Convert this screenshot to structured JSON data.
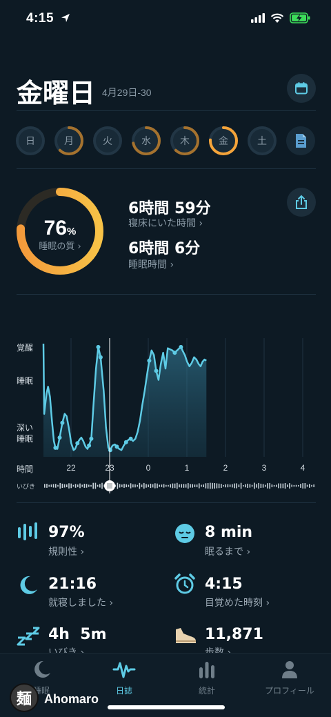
{
  "status": {
    "time": "4:15"
  },
  "header": {
    "day": "金曜日",
    "date_range": "4月29日-30"
  },
  "week": [
    {
      "label": "日",
      "fill": 0,
      "active": false
    },
    {
      "label": "月",
      "fill": 0.62,
      "active": false
    },
    {
      "label": "火",
      "fill": 0,
      "active": false
    },
    {
      "label": "水",
      "fill": 0.72,
      "active": false
    },
    {
      "label": "木",
      "fill": 0.62,
      "active": false
    },
    {
      "label": "金",
      "fill": 0.76,
      "active": true
    },
    {
      "label": "土",
      "fill": 0,
      "active": false
    }
  ],
  "summary": {
    "quality_value": "76",
    "quality_unit": "%",
    "quality_label": "睡眠の質 ›",
    "quality_fraction": 0.76,
    "time_in_bed": "6時間 59分",
    "time_in_bed_label": "寝床にいた時間 ›",
    "sleep_time": "6時間 6分",
    "sleep_time_label": "睡眠時間 ›"
  },
  "chart_data": {
    "type": "line",
    "y_labels": [
      "覚醒",
      "睡眠",
      "深い\n睡眠"
    ],
    "x_axis_label": "時間",
    "x_ticks": [
      "22",
      "23",
      "0",
      "1",
      "2",
      "3",
      "4"
    ],
    "snore_label": "いびき",
    "series": [
      {
        "x": [
          0.0,
          0.02,
          0.08,
          0.12,
          0.17,
          0.22,
          0.27,
          0.31,
          0.36,
          0.42,
          0.49,
          0.55,
          0.6,
          0.66,
          0.72,
          0.78,
          0.82,
          0.88,
          0.93,
          0.98,
          1.03,
          1.09,
          1.14,
          1.18,
          1.24,
          1.3,
          1.36,
          1.42,
          1.48,
          1.56,
          1.62,
          1.68,
          1.73,
          1.79,
          1.85,
          1.9,
          1.96,
          2.02,
          2.08,
          2.14,
          2.2,
          2.26,
          2.32,
          2.38,
          2.44,
          2.5,
          2.56,
          2.62,
          2.68,
          2.74,
          2.8,
          2.86,
          2.92,
          2.98,
          3.04,
          3.1,
          3.16,
          3.22,
          3.28,
          3.34,
          3.4,
          3.46,
          3.52,
          3.56,
          3.6,
          3.66,
          3.72,
          3.78,
          3.84,
          3.9,
          3.96,
          4.02,
          4.07,
          4.12,
          4.17,
          4.22
        ],
        "y": [
          1.0,
          0.38,
          0.56,
          0.62,
          0.53,
          0.32,
          0.14,
          0.08,
          0.07,
          0.17,
          0.3,
          0.38,
          0.36,
          0.25,
          0.12,
          0.06,
          0.07,
          0.12,
          0.15,
          0.17,
          0.14,
          0.09,
          0.07,
          0.1,
          0.16,
          0.48,
          0.78,
          0.97,
          0.88,
          0.58,
          0.26,
          0.08,
          0.06,
          0.1,
          0.11,
          0.09,
          0.07,
          0.06,
          0.1,
          0.13,
          0.15,
          0.16,
          0.14,
          0.16,
          0.22,
          0.32,
          0.46,
          0.58,
          0.72,
          0.85,
          0.94,
          0.9,
          0.76,
          0.68,
          0.82,
          0.92,
          0.78,
          0.96,
          0.95,
          0.94,
          0.92,
          0.94,
          0.96,
          0.97,
          0.94,
          0.9,
          0.84,
          0.8,
          0.83,
          0.88,
          0.86,
          0.82,
          0.8,
          0.84,
          0.86,
          0.85
        ]
      }
    ]
  },
  "stats": [
    {
      "value": "97%",
      "label": "規則性 ›",
      "icon": "bars-icon"
    },
    {
      "value": "8 min",
      "label": "眠るまで ›",
      "icon": "sleepy-face-icon"
    },
    {
      "value": "21:16",
      "label": "就寝しました ›",
      "icon": "moon-icon"
    },
    {
      "value": "4:15",
      "label": "目覚めた時刻 ›",
      "icon": "alarm-clock-icon"
    },
    {
      "value": "4h  5m",
      "label": "いびき ›",
      "icon": "zzz-icon"
    },
    {
      "value": "11,871",
      "label": "歩数 ›",
      "icon": "shoe-icon"
    }
  ],
  "tabs": [
    {
      "label": "睡眠",
      "active": false
    },
    {
      "label": "日誌",
      "active": true
    },
    {
      "label": "統計",
      "active": false
    },
    {
      "label": "プロフィール",
      "active": false
    }
  ],
  "overlay": {
    "name": "Ahomaro",
    "badge_char": "麺"
  },
  "colors": {
    "accent": "#5ecbe5",
    "orange": "#f5a43a",
    "bg": "#0d1a24"
  }
}
